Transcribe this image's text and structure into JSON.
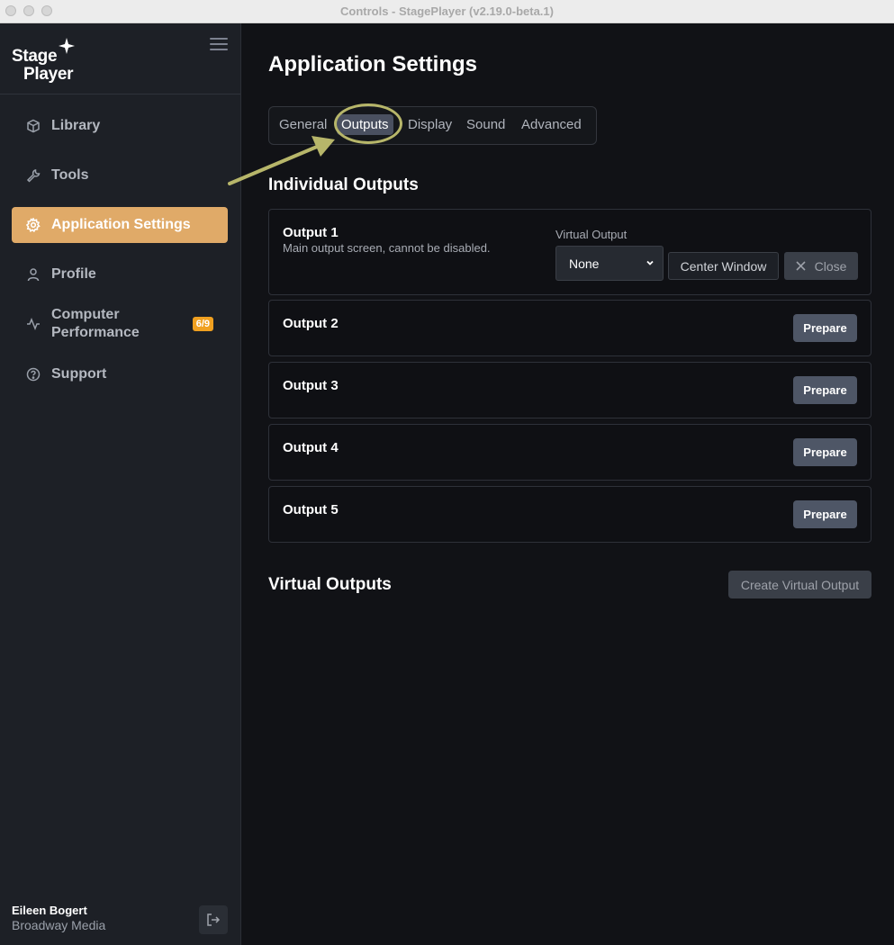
{
  "window": {
    "title": "Controls - StagePlayer (v2.19.0-beta.1)"
  },
  "sidebar": {
    "logo": {
      "line1": "Stage",
      "line2": "Player"
    },
    "items": [
      {
        "label": "Library",
        "icon": "cube-icon"
      },
      {
        "label": "Tools",
        "icon": "wrench-icon"
      },
      {
        "label": "Application Settings",
        "icon": "gear-icon",
        "active": true
      },
      {
        "label": "Profile",
        "icon": "user-icon"
      },
      {
        "label": "Computer",
        "label2": "Performance",
        "icon": "activity-icon",
        "badge": "6/9"
      },
      {
        "label": "Support",
        "icon": "help-circle-icon"
      }
    ],
    "user": {
      "name": "Eileen Bogert",
      "org": "Broadway Media"
    }
  },
  "main": {
    "title": "Application Settings",
    "tabs": [
      "General",
      "Outputs",
      "Display",
      "Sound",
      "Advanced"
    ],
    "active_tab": "Outputs",
    "individual_outputs_title": "Individual Outputs",
    "outputs": [
      {
        "title": "Output 1",
        "desc": "Main output screen, cannot be disabled."
      },
      {
        "title": "Output 2",
        "button": "Prepare"
      },
      {
        "title": "Output 3",
        "button": "Prepare"
      },
      {
        "title": "Output 4",
        "button": "Prepare"
      },
      {
        "title": "Output 5",
        "button": "Prepare"
      }
    ],
    "virtual_output": {
      "label": "Virtual Output",
      "selected": "None",
      "center_button": "Center Window",
      "close_button": "Close"
    },
    "virtual_outputs_title": "Virtual Outputs",
    "create_button": "Create Virtual Output"
  },
  "colors": {
    "accent": "#e0aa68",
    "badge": "#f0a020",
    "annotation": "#b7b66a"
  }
}
